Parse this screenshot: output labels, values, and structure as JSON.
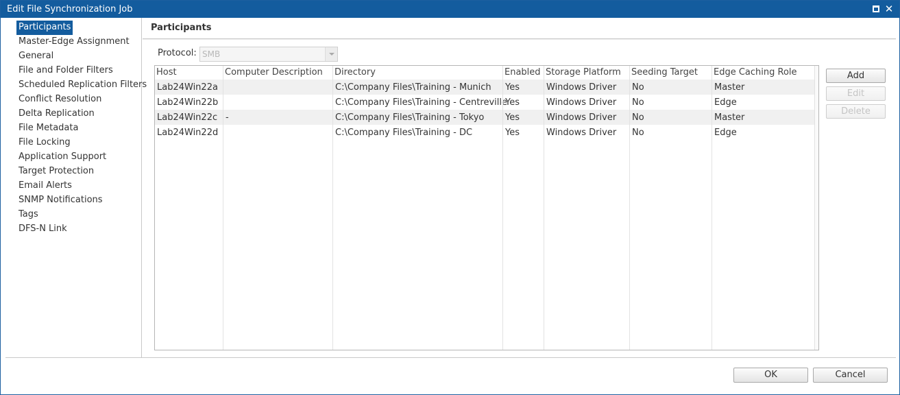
{
  "window": {
    "title": "Edit File Synchronization Job"
  },
  "sidebar": {
    "items": [
      {
        "label": "Participants",
        "active": true
      },
      {
        "label": "Master-Edge Assignment"
      },
      {
        "label": "General"
      },
      {
        "label": "File and Folder Filters"
      },
      {
        "label": "Scheduled Replication Filters"
      },
      {
        "label": "Conflict Resolution"
      },
      {
        "label": "Delta Replication"
      },
      {
        "label": "File Metadata"
      },
      {
        "label": "File Locking"
      },
      {
        "label": "Application Support"
      },
      {
        "label": "Target Protection"
      },
      {
        "label": "Email Alerts"
      },
      {
        "label": "SNMP Notifications"
      },
      {
        "label": "Tags"
      },
      {
        "label": "DFS-N Link"
      }
    ]
  },
  "main": {
    "title": "Participants",
    "protocol": {
      "label": "Protocol:",
      "value": "SMB",
      "disabled": true
    }
  },
  "table": {
    "columns": [
      "Host",
      "Computer Description",
      "Directory",
      "Enabled",
      "Storage Platform",
      "Seeding Target",
      "Edge Caching Role"
    ],
    "rows": [
      [
        "Lab24Win22a",
        "",
        "C:\\Company Files\\Training - Munich",
        "Yes",
        "Windows Driver",
        "No",
        "Master"
      ],
      [
        "Lab24Win22b",
        "",
        "C:\\Company Files\\Training - Centreville",
        "Yes",
        "Windows Driver",
        "No",
        "Edge"
      ],
      [
        "Lab24Win22c",
        "-",
        "C:\\Company Files\\Training - Tokyo",
        "Yes",
        "Windows Driver",
        "No",
        "Master"
      ],
      [
        "Lab24Win22d",
        "",
        "C:\\Company Files\\Training - DC",
        "Yes",
        "Windows Driver",
        "No",
        "Edge"
      ]
    ]
  },
  "actions": {
    "add": "Add",
    "edit": "Edit",
    "delete": "Delete",
    "edit_disabled": true,
    "delete_disabled": true
  },
  "footer": {
    "ok": "OK",
    "cancel": "Cancel"
  },
  "colors": {
    "titlebar": "#135c9e",
    "selection": "#135c9e",
    "alt_row": "#f0f0f0"
  },
  "icons": {
    "maximize": "maximize-icon",
    "close": "close-icon"
  }
}
